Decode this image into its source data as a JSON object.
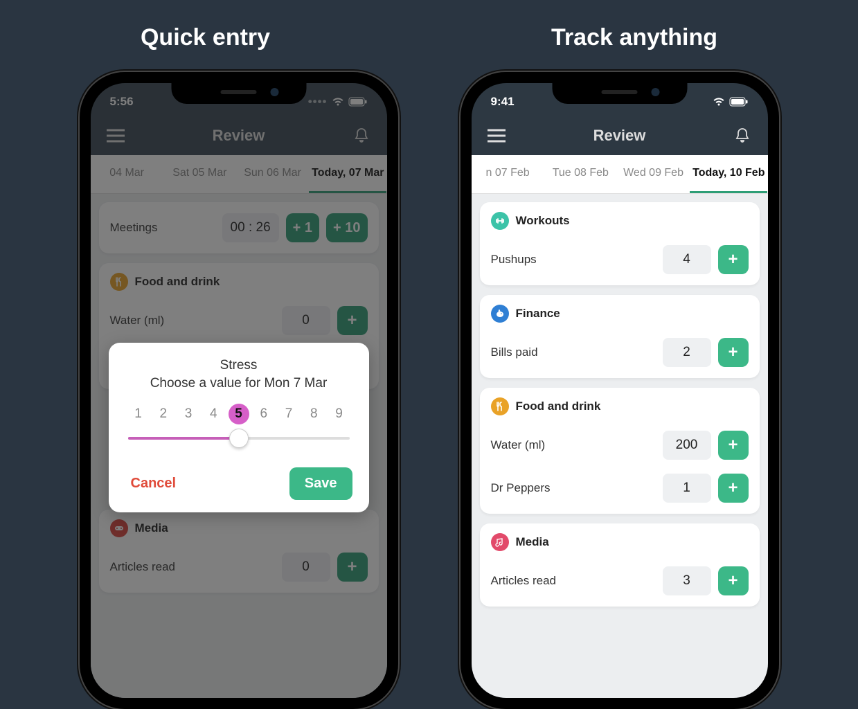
{
  "headings": {
    "left": "Quick entry",
    "right": "Track anything"
  },
  "phone1": {
    "status_time": "5:56",
    "app_title": "Review",
    "tabs": [
      {
        "label": "04 Mar",
        "active": false
      },
      {
        "label": "Sat 05 Mar",
        "active": false
      },
      {
        "label": "Sun 06 Mar",
        "active": false
      },
      {
        "label": "Today, 07 Mar",
        "active": true
      }
    ],
    "top_row": {
      "label": "Meetings",
      "value": "00 : 26",
      "btn1": "+ 1",
      "btn2": "+ 10"
    },
    "cards": [
      {
        "icon_color": "#e9a227",
        "icon": "utensils",
        "title": "Food and drink",
        "rows": [
          {
            "label": "Water (ml)",
            "value": "0"
          }
        ]
      },
      {
        "icon_color": "#d9413b",
        "icon": "gamepad",
        "title": "Media",
        "rows": [
          {
            "label": "Articles read",
            "value": "0"
          }
        ]
      }
    ],
    "modal": {
      "title": "Stress",
      "subtitle": "Choose a value for Mon 7 Mar",
      "scale": [
        "1",
        "2",
        "3",
        "4",
        "5",
        "6",
        "7",
        "8",
        "9"
      ],
      "selected": "5",
      "cancel": "Cancel",
      "save": "Save"
    }
  },
  "phone2": {
    "status_time": "9:41",
    "app_title": "Review",
    "tabs": [
      {
        "label": "n 07 Feb",
        "active": false
      },
      {
        "label": "Tue 08 Feb",
        "active": false
      },
      {
        "label": "Wed 09 Feb",
        "active": false
      },
      {
        "label": "Today, 10 Feb",
        "active": true
      }
    ],
    "cards": [
      {
        "icon_color": "#3cc3a8",
        "icon": "dumbbell",
        "title": "Workouts",
        "rows": [
          {
            "label": "Pushups",
            "value": "4"
          }
        ]
      },
      {
        "icon_color": "#2f7fd4",
        "icon": "piggy",
        "title": "Finance",
        "rows": [
          {
            "label": "Bills paid",
            "value": "2"
          }
        ]
      },
      {
        "icon_color": "#e9a227",
        "icon": "utensils",
        "title": "Food and drink",
        "rows": [
          {
            "label": "Water (ml)",
            "value": "200"
          },
          {
            "label": "Dr Peppers",
            "value": "1"
          }
        ]
      },
      {
        "icon_color": "#e24a6a",
        "icon": "music",
        "title": "Media",
        "rows": [
          {
            "label": "Articles read",
            "value": "3"
          }
        ]
      }
    ]
  },
  "icons": {
    "plus_label": "+"
  }
}
